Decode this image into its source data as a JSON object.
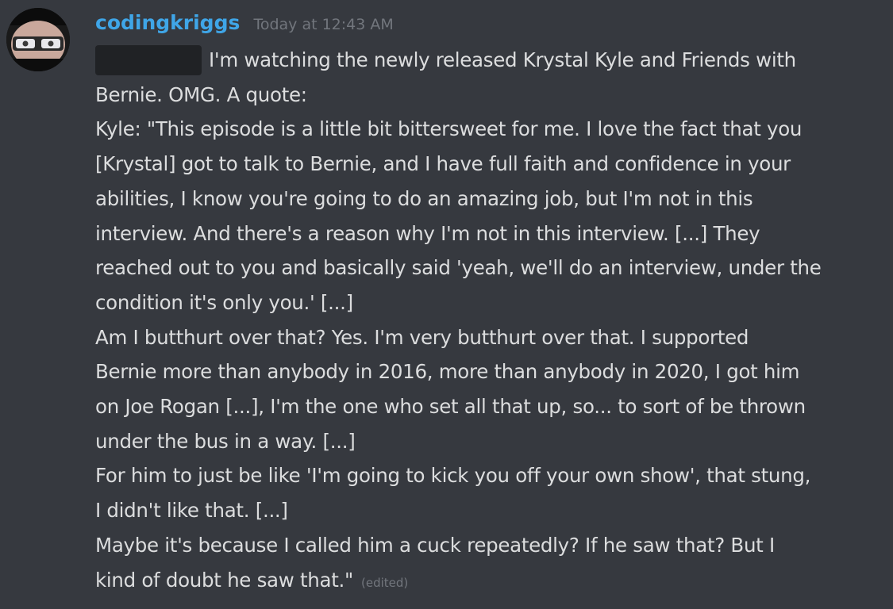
{
  "message": {
    "author": "codingkriggs",
    "timestamp": "Today at 12:43 AM",
    "lines": [
      "I'm watching the newly released Krystal Kyle and Friends with",
      "Bernie. OMG. A quote:",
      "Kyle: \"This episode is a little bit bittersweet for me. I love the fact that you",
      "[Krystal] got to talk to Bernie, and I have full faith and confidence in your",
      "abilities, I know you're going to do an amazing job, but I'm not in this",
      "interview. And there's a reason why I'm not in this interview. [...] They",
      "reached out to you and basically said 'yeah, we'll do an interview, under the",
      "condition it's only you.' [...]",
      "Am I butthurt over that? Yes. I'm very butthurt over that. I supported",
      "Bernie more than anybody in 2016, more than anybody in 2020, I got him",
      "on Joe Rogan [...], I'm the one who set all that up, so... to sort of be thrown",
      "under the bus in a way. [...]",
      "For him to just be like 'I'm going to kick you off your own show', that stung,",
      "I didn't like that. [...]",
      "Maybe it's because I called him a cuck repeatedly? If he saw that? But I",
      "kind of doubt he saw that.\""
    ],
    "edited_label": "(edited)"
  },
  "colors": {
    "background": "#36393f",
    "username": "#3fa6e8",
    "text": "#dcddde",
    "muted": "#72767d",
    "redaction": "#202225"
  },
  "icons": {
    "avatar": "user-avatar-glasses-icon"
  }
}
